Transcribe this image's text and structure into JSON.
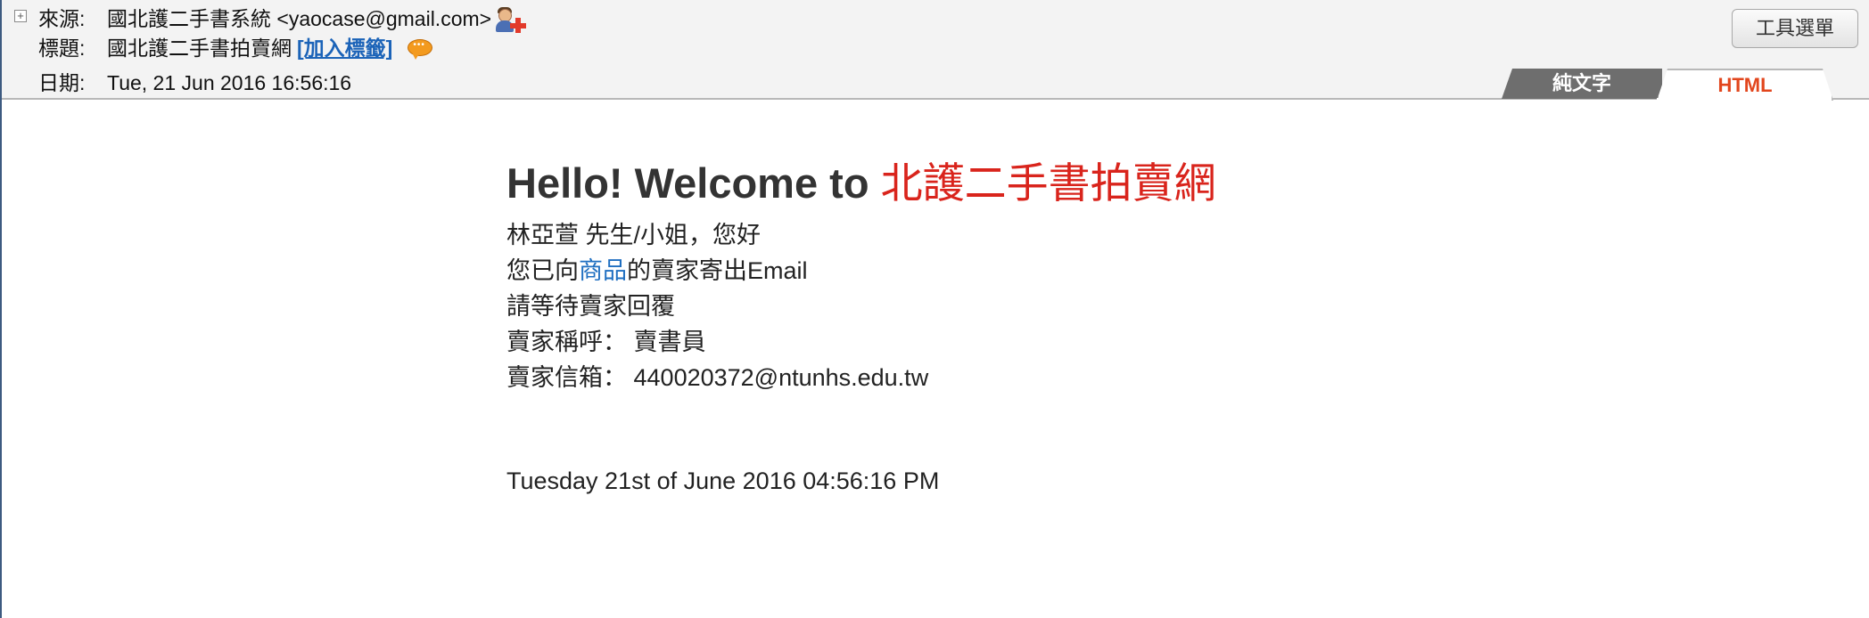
{
  "header": {
    "from_label": "來源:",
    "from_value": "國北護二手書系統 <yaocase@gmail.com>",
    "subject_label": "標題:",
    "subject_value": "國北護二手書拍賣網",
    "add_tag_link": "[加入標籤]",
    "date_label": "日期:",
    "date_value": "Tue, 21 Jun 2016 16:56:16",
    "expand_symbol": "+",
    "icons": {
      "contact": "add-contact-icon",
      "comment": "comment-bubble-icon"
    }
  },
  "toolbar": {
    "tools_menu_label": "工具選單"
  },
  "view_tabs": {
    "plain_text": "純文字",
    "html": "HTML",
    "active": "HTML"
  },
  "message": {
    "welcome_prefix": "Hello! Welcome to ",
    "site_name": "北護二手書拍賣網",
    "greeting": "林亞萱 先生/小姐，您好",
    "sent_prefix": "您已向",
    "product_link": "商品",
    "sent_suffix": "的賣家寄出Email",
    "wait_line": "請等待賣家回覆",
    "seller_name_label": "賣家稱呼：",
    "seller_name": "賣書員",
    "seller_email_label": "賣家信箱：",
    "seller_email": "440020372@ntunhs.edu.tw",
    "timestamp": "Tuesday 21st of June 2016 04:56:16 PM"
  },
  "colors": {
    "site_name": "#d9241c",
    "link": "#1f6fc1",
    "active_tab_text": "#e2461d",
    "inactive_tab_bg": "#6e6e6e",
    "header_bg": "#f3f3f3"
  }
}
